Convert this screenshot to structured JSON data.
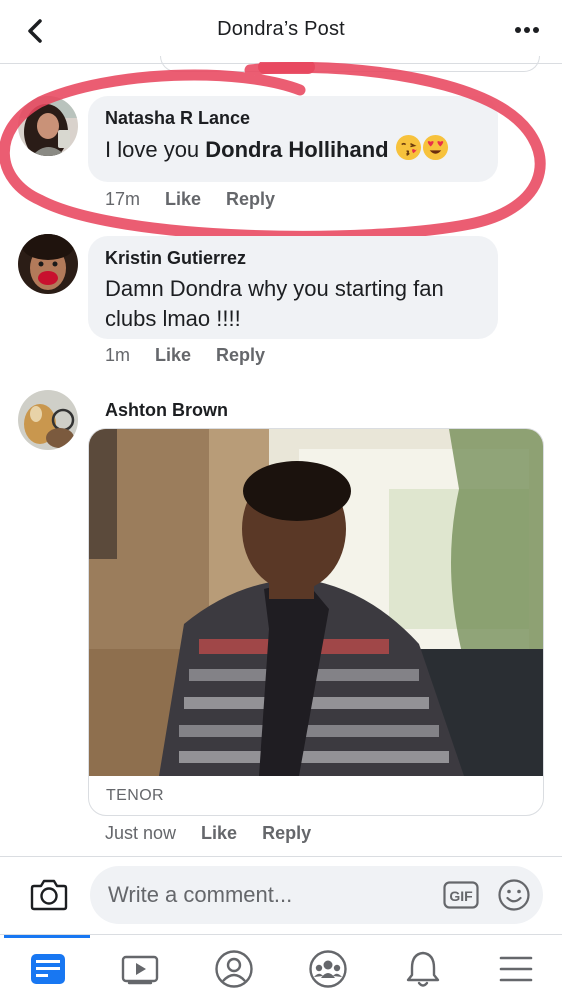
{
  "header": {
    "title": "Dondra’s Post",
    "back_icon": "chevron-left-icon",
    "more_icon": "more-horizontal-icon"
  },
  "comments": [
    {
      "author": "Natasha R Lance",
      "text_prefix": "I love you ",
      "mention": "Dondra Hollihand",
      "emojis": [
        "kissing-face-emoji",
        "heart-eyes-emoji"
      ],
      "time": "17m",
      "like_label": "Like",
      "reply_label": "Reply"
    },
    {
      "author": "Kristin Gutierrez",
      "text": "Damn Dondra why you starting fan clubs lmao !!!!",
      "time": "1m",
      "like_label": "Like",
      "reply_label": "Reply"
    },
    {
      "author": "Ashton Brown",
      "gif_source": "TENOR",
      "time": "Just now",
      "like_label": "Like",
      "reply_label": "Reply"
    }
  ],
  "annotation_color": "#e8475f",
  "composer": {
    "placeholder": "Write a comment...",
    "camera_icon": "camera-icon",
    "gif_label": "GIF",
    "emoji_icon": "smiley-icon"
  },
  "bottom_nav": [
    {
      "icon": "news-feed-icon",
      "active": true
    },
    {
      "icon": "watch-video-icon",
      "active": false
    },
    {
      "icon": "profile-icon",
      "active": false
    },
    {
      "icon": "groups-icon",
      "active": false
    },
    {
      "icon": "notifications-bell-icon",
      "active": false
    },
    {
      "icon": "menu-icon",
      "active": false
    }
  ],
  "colors": {
    "accent": "#1877f2",
    "bubble": "#f0f2f5",
    "secondary_text": "#65676b"
  }
}
